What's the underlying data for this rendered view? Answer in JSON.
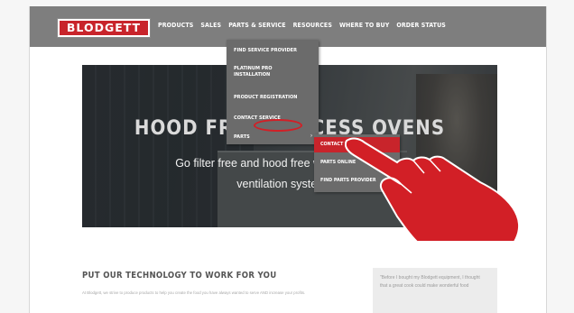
{
  "header": {
    "logo_text": "BLODGETT",
    "nav": [
      {
        "label": "PRODUCTS"
      },
      {
        "label": "SALES"
      },
      {
        "label": "PARTS & SERVICE"
      },
      {
        "label": "RESOURCES"
      },
      {
        "label": "WHERE TO BUY"
      },
      {
        "label": "ORDER STATUS"
      }
    ]
  },
  "dropdown": {
    "items": [
      {
        "label": "FIND SERVICE PROVIDER"
      },
      {
        "label": "PLATINUM PRO INSTALLATION"
      },
      {
        "label": "PRODUCT REGISTRATION"
      },
      {
        "label": "CONTACT SERVICE"
      },
      {
        "label": "PARTS"
      }
    ],
    "parts_arrow": "›"
  },
  "submenu": {
    "items": [
      {
        "label": "CONTACT PARTS",
        "active": true
      },
      {
        "label": "PARTS ONLINE"
      },
      {
        "label": "FIND PARTS PROVIDER"
      }
    ]
  },
  "hero": {
    "title": "HOOD FREE PROCESS OVENS",
    "line1": "Go filter free and hood free with our incredible",
    "line2": "ventilation system for"
  },
  "section": {
    "title": "PUT OUR TECHNOLOGY TO WORK FOR YOU",
    "text": "At Blodgett, we strive to produce products to help you create the food you have always wanted to serve AND increase your profits."
  },
  "testimonial": {
    "text": "\"Before I bought my Blodgett equipment, I thought that a great cook could make wonderful food"
  },
  "colors": {
    "brand_red": "#c8242b",
    "nav_gray": "#7e7e7e",
    "menu_gray": "#6b6b6b",
    "annotation_red": "#d21f26"
  }
}
